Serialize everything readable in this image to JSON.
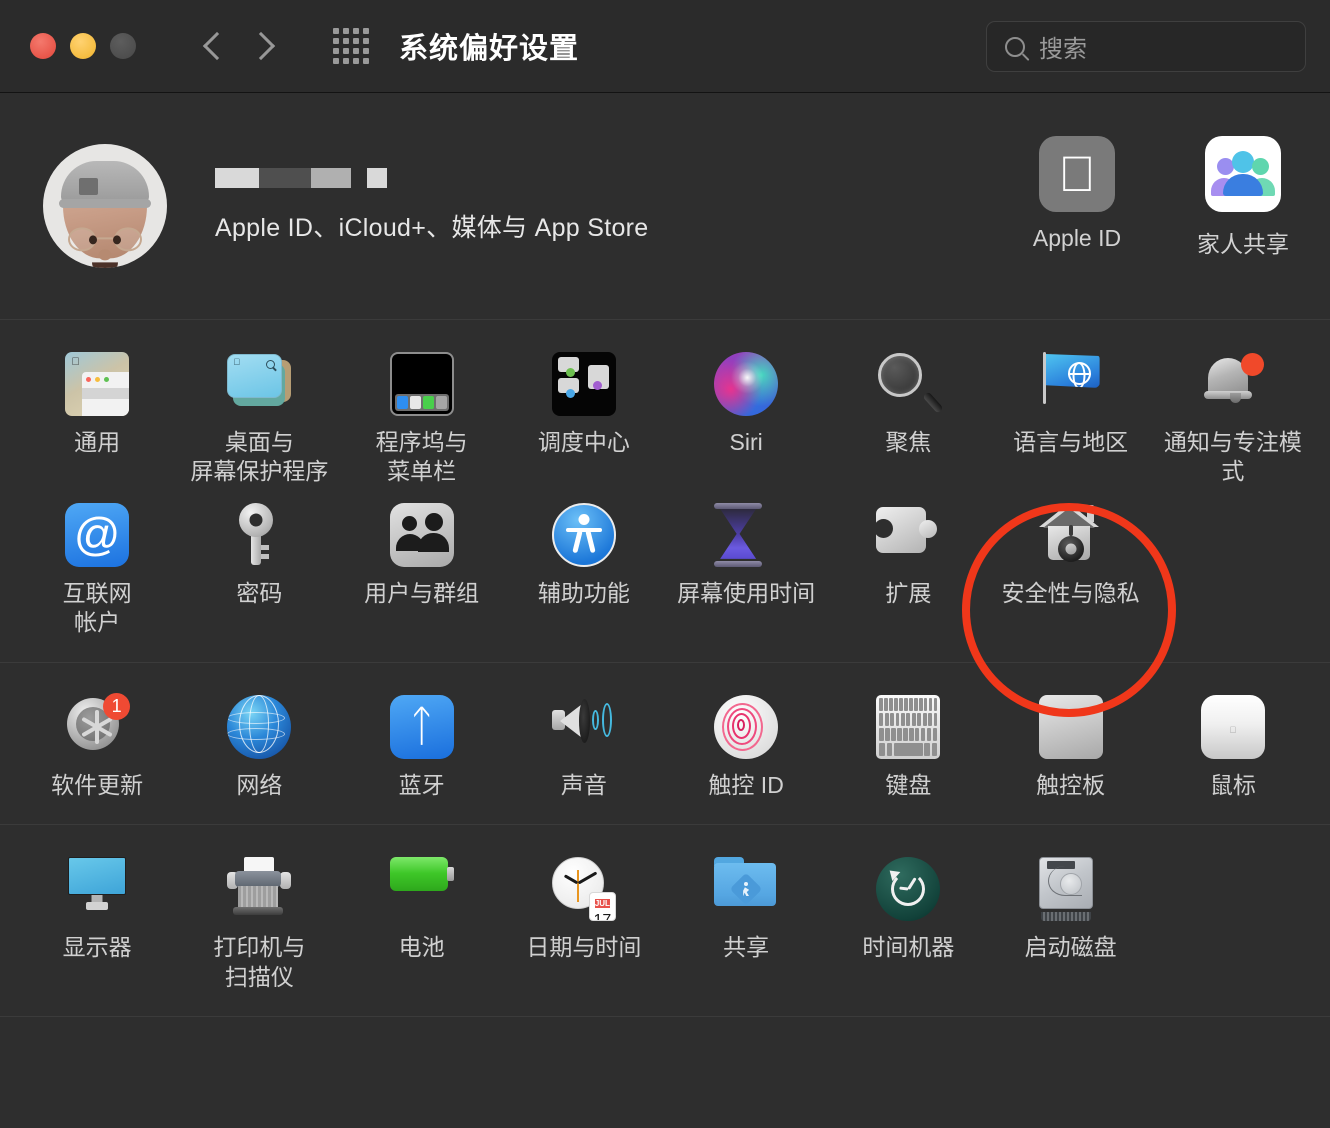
{
  "window": {
    "title": "系统偏好设置",
    "traffic_lights": [
      "close-red",
      "minimize-yellow",
      "zoom-disabled-gray"
    ],
    "nav": {
      "back": "back-chevron",
      "forward": "forward-chevron",
      "grid": "show-all-grid"
    },
    "search": {
      "placeholder": "搜索",
      "value": ""
    }
  },
  "account": {
    "name_redacted": true,
    "subtitle": "Apple ID、iCloud+、媒体与 App Store",
    "avatar": "memoji-avatar",
    "tiles": [
      {
        "label": "Apple ID",
        "icon": "apple-logo-icon"
      },
      {
        "label": "家人共享",
        "icon": "family-sharing-icon"
      }
    ]
  },
  "sections": [
    {
      "name": "personal",
      "items": [
        {
          "label": "通用",
          "icon": "general-icon",
          "badge": ""
        },
        {
          "label": "桌面与\n屏幕保护程序",
          "icon": "desktop-screensaver-icon",
          "badge": ""
        },
        {
          "label": "程序坞与\n菜单栏",
          "icon": "dock-menubar-icon",
          "badge": ""
        },
        {
          "label": "调度中心",
          "icon": "mission-control-icon",
          "badge": ""
        },
        {
          "label": "Siri",
          "icon": "siri-icon",
          "badge": ""
        },
        {
          "label": "聚焦",
          "icon": "spotlight-icon",
          "badge": ""
        },
        {
          "label": "语言与地区",
          "icon": "language-region-icon",
          "badge": ""
        },
        {
          "label": "通知与专注模式",
          "icon": "notifications-focus-icon",
          "badge": ""
        },
        {
          "label": "互联网\n帐户",
          "icon": "internet-accounts-icon",
          "badge": ""
        },
        {
          "label": "密码",
          "icon": "passwords-key-icon",
          "badge": ""
        },
        {
          "label": "用户与群组",
          "icon": "users-groups-icon",
          "badge": ""
        },
        {
          "label": "辅助功能",
          "icon": "accessibility-icon",
          "badge": ""
        },
        {
          "label": "屏幕使用时间",
          "icon": "screen-time-icon",
          "badge": ""
        },
        {
          "label": "扩展",
          "icon": "extensions-puzzle-icon",
          "badge": ""
        },
        {
          "label": "安全性与隐私",
          "icon": "security-privacy-icon",
          "badge": ""
        }
      ]
    },
    {
      "name": "hardware",
      "items": [
        {
          "label": "软件更新",
          "icon": "software-update-icon",
          "badge": "1"
        },
        {
          "label": "网络",
          "icon": "network-globe-icon",
          "badge": ""
        },
        {
          "label": "蓝牙",
          "icon": "bluetooth-icon",
          "badge": ""
        },
        {
          "label": "声音",
          "icon": "sound-speaker-icon",
          "badge": ""
        },
        {
          "label": "触控 ID",
          "icon": "touch-id-icon",
          "badge": ""
        },
        {
          "label": "键盘",
          "icon": "keyboard-icon",
          "badge": ""
        },
        {
          "label": "触控板",
          "icon": "trackpad-icon",
          "badge": ""
        },
        {
          "label": "鼠标",
          "icon": "mouse-icon",
          "badge": ""
        }
      ]
    },
    {
      "name": "system",
      "items": [
        {
          "label": "显示器",
          "icon": "displays-icon",
          "badge": ""
        },
        {
          "label": "打印机与\n扫描仪",
          "icon": "printers-scanners-icon",
          "badge": ""
        },
        {
          "label": "电池",
          "icon": "battery-icon",
          "badge": ""
        },
        {
          "label": "日期与时间",
          "icon": "date-time-icon",
          "badge": ""
        },
        {
          "label": "共享",
          "icon": "sharing-folder-icon",
          "badge": ""
        },
        {
          "label": "时间机器",
          "icon": "time-machine-icon",
          "badge": ""
        },
        {
          "label": "启动磁盘",
          "icon": "startup-disk-icon",
          "badge": ""
        }
      ]
    }
  ],
  "date_time_icon": {
    "month": "JUL",
    "day": "17"
  },
  "annotation": {
    "type": "highlight-circle",
    "target_label": "安全性与隐私",
    "color": "#f0371a"
  },
  "colors": {
    "window_bg": "#2e2e2e",
    "titlebar_bg": "#2b2b2b",
    "label_text": "#d0d0d0",
    "title_text": "#ffffff",
    "divider": "#3b3b3b",
    "annotation": "#f0371a",
    "badge": "#ef4a33"
  }
}
